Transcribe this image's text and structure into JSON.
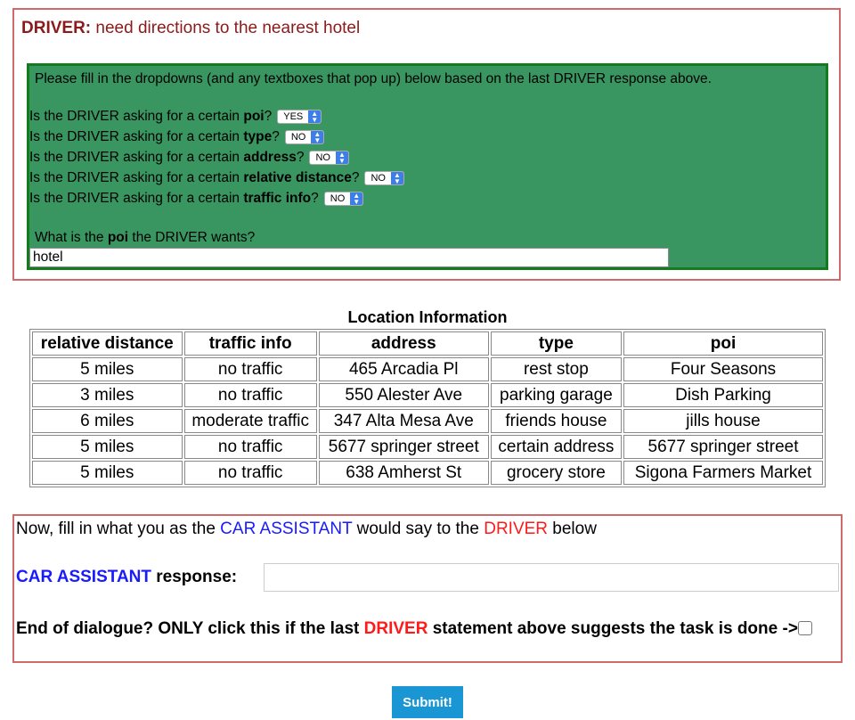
{
  "driver": {
    "prefix": "DRIVER:",
    "message": "need directions to the nearest hotel"
  },
  "form": {
    "instructions": "Please fill in the dropdowns (and any textboxes that pop up) below based on the last DRIVER response above.",
    "question_prefix": "Is the DRIVER asking for a certain",
    "questions": [
      {
        "field": "poi",
        "value": "YES"
      },
      {
        "field": "type",
        "value": "NO"
      },
      {
        "field": "address",
        "value": "NO"
      },
      {
        "field": "relative distance",
        "value": "NO"
      },
      {
        "field": "traffic info",
        "value": "NO"
      }
    ],
    "poi_question_pre": "What is the",
    "poi_question_field": "poi",
    "poi_question_post": "the DRIVER wants?",
    "poi_value": "hotel"
  },
  "table": {
    "title": "Location Information",
    "headers": [
      "relative distance",
      "traffic info",
      "address",
      "type",
      "poi"
    ],
    "rows": [
      [
        "5 miles",
        "no traffic",
        "465 Arcadia Pl",
        "rest stop",
        "Four Seasons"
      ],
      [
        "3 miles",
        "no traffic",
        "550 Alester Ave",
        "parking garage",
        "Dish Parking"
      ],
      [
        "6 miles",
        "moderate traffic",
        "347 Alta Mesa Ave",
        "friends house",
        "jills house"
      ],
      [
        "5 miles",
        "no traffic",
        "5677 springer street",
        "certain address",
        "5677 springer street"
      ],
      [
        "5 miles",
        "no traffic",
        "638 Amherst St",
        "grocery store",
        "Sigona Farmers Market"
      ]
    ]
  },
  "assistant": {
    "fill_pre": "Now, fill in what you as the",
    "fill_assistant": "CAR ASSISTANT",
    "fill_mid": "would say to the",
    "fill_driver": "DRIVER",
    "fill_post": "below",
    "response_label_role": "CAR ASSISTANT",
    "response_label_text": "response:",
    "response_value": "",
    "end_pre": "End of dialogue? ONLY click this if the last",
    "end_driver": "DRIVER",
    "end_post": "statement above suggests the task is done ->"
  },
  "submit_label": "Submit!"
}
